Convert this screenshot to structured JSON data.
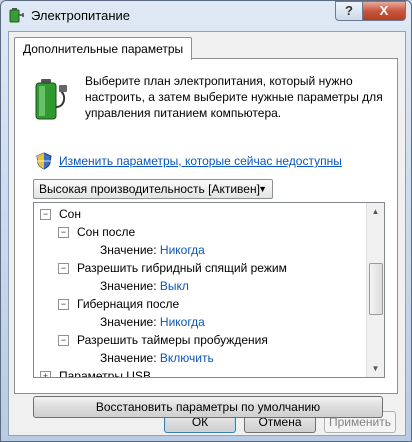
{
  "window": {
    "title": "Электропитание",
    "help_label": "?",
    "close_label": "X"
  },
  "tab": {
    "label": "Дополнительные параметры"
  },
  "description": "Выберите план электропитания, который нужно настроить, а затем выберите нужные параметры для управления питанием компьютера.",
  "change_link": "Изменить параметры, которые сейчас недоступны",
  "plan_select": {
    "value": "Высокая производительность [Активен]"
  },
  "tree": {
    "sleep": {
      "label": "Сон",
      "expander": "⊟"
    },
    "sleep_after": {
      "label": "Сон после",
      "value_label": "Значение:",
      "value": "Никогда"
    },
    "hybrid": {
      "label": "Разрешить гибридный спящий режим",
      "value_label": "Значение:",
      "value": "Выкл"
    },
    "hibernate": {
      "label": "Гибернация после",
      "value_label": "Значение:",
      "value": "Никогда"
    },
    "wake_timers": {
      "label": "Разрешить таймеры пробуждения",
      "value_label": "Значение:",
      "value": "Включить"
    },
    "usb": {
      "label": "Параметры USB"
    }
  },
  "restore_button": "Восстановить параметры по умолчанию",
  "buttons": {
    "ok": "ОК",
    "cancel": "Отмена",
    "apply": "Применить"
  },
  "icons": {
    "app": "power-options-icon",
    "battery": "battery-plug-icon",
    "shield": "uac-shield-icon"
  }
}
